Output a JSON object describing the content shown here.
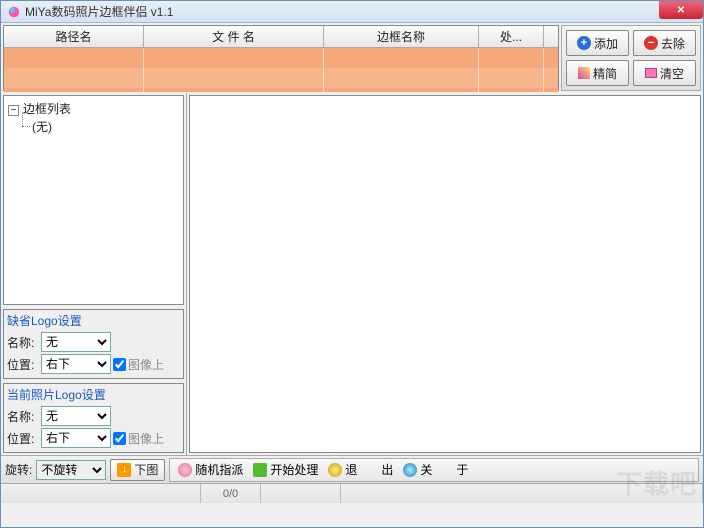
{
  "window": {
    "title": "MiYa数码照片边框伴侣 v1.1"
  },
  "grid": {
    "columns": [
      "路径名",
      "文 件 名",
      "边框名称",
      "处..."
    ]
  },
  "buttons": {
    "add": "添加",
    "remove": "去除",
    "simplify": "精简",
    "clear": "清空"
  },
  "tree": {
    "root": "边框列表",
    "child": "(无)"
  },
  "logoDefault": {
    "legend": "缺省Logo设置",
    "nameLabel": "名称:",
    "nameValue": "无",
    "posLabel": "位置:",
    "posValue": "右下",
    "imageHint": "图像上"
  },
  "logoCurrent": {
    "legend": "当前照片Logo设置",
    "nameLabel": "名称:",
    "nameValue": "无",
    "posLabel": "位置:",
    "posValue": "右下",
    "imageHint": "图像上"
  },
  "bottom": {
    "rotateLabel": "旋转:",
    "rotateValue": "不旋转",
    "nextImage": "下图",
    "random": "随机指派",
    "start": "开始处理",
    "exit": "退　　出",
    "about": "关　　于"
  },
  "status": {
    "counter": "0/0"
  },
  "watermark": "下载吧"
}
